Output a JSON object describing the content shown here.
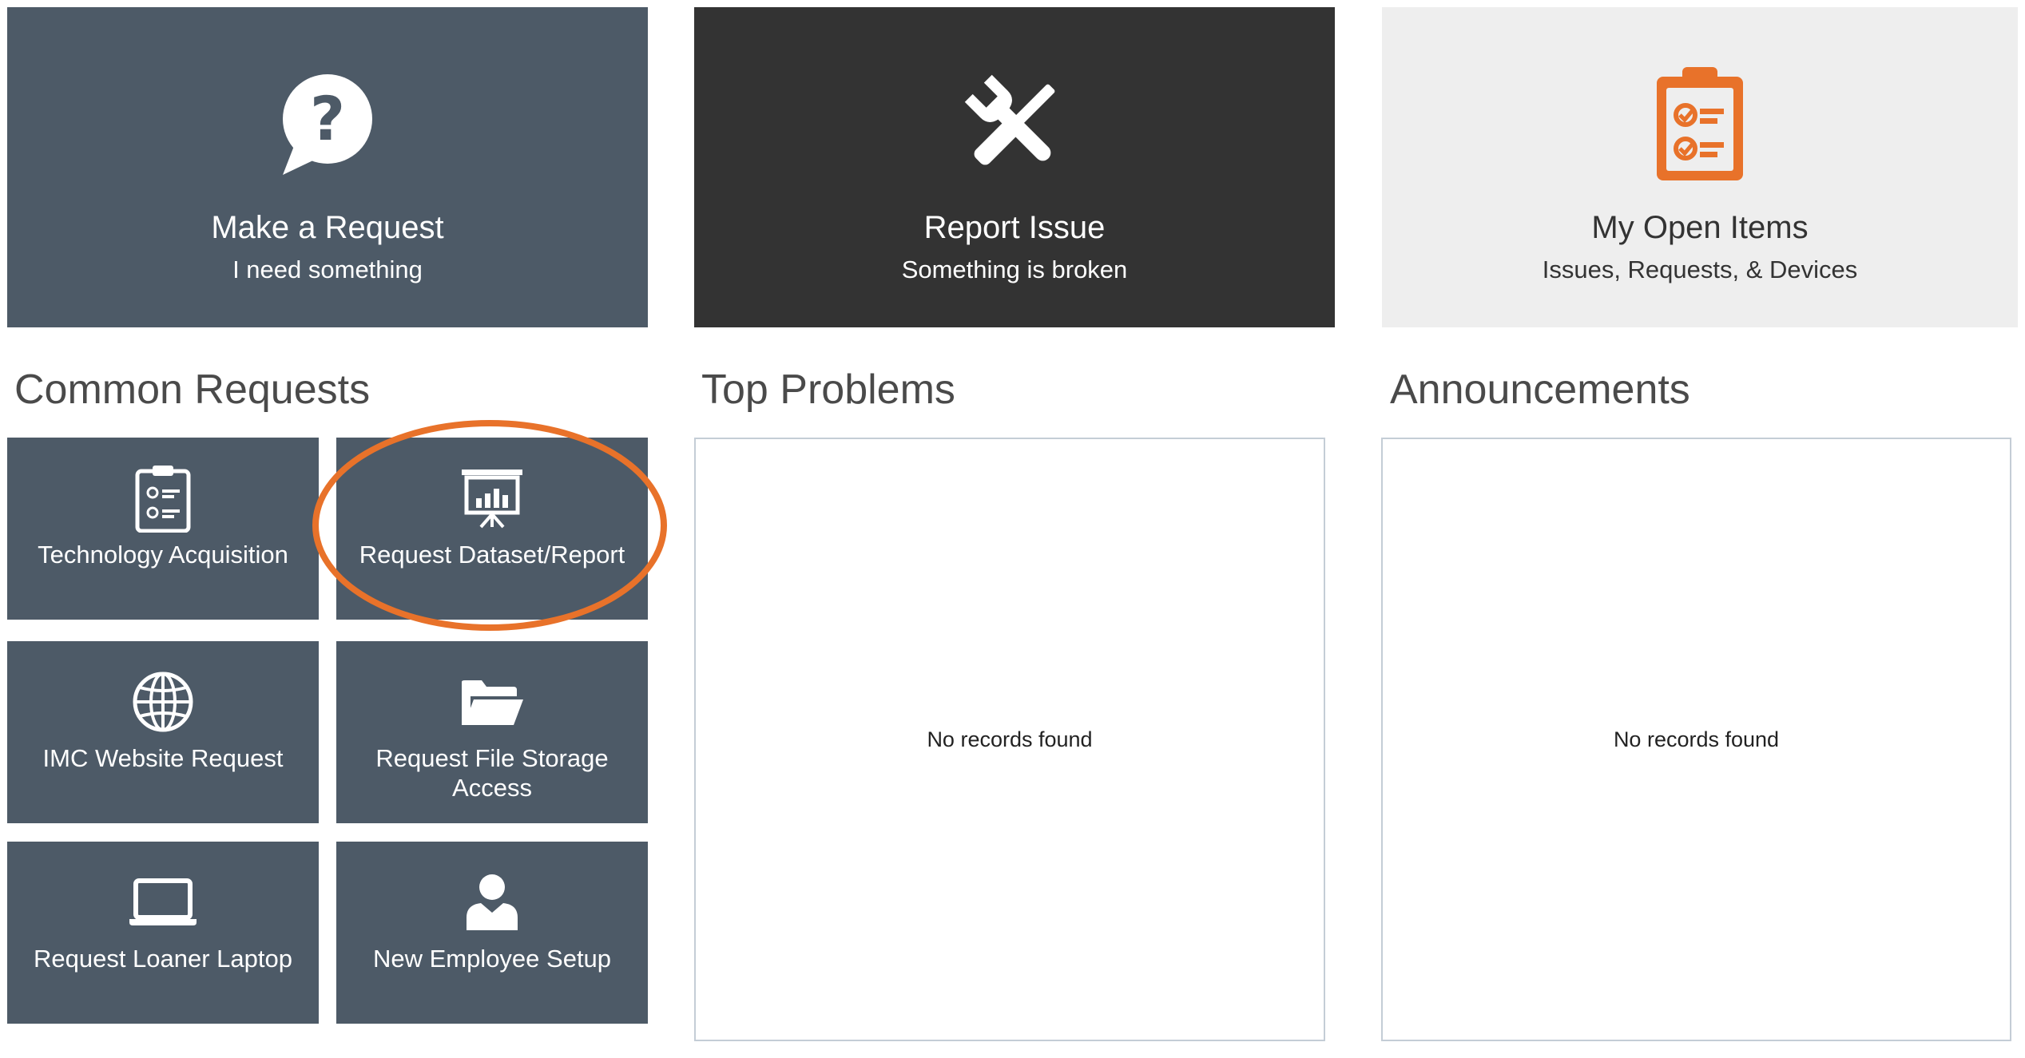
{
  "hero_cards": [
    {
      "title": "Make a Request",
      "subtitle": "I need something",
      "icon": "question-bubble-icon"
    },
    {
      "title": "Report Issue",
      "subtitle": "Something is broken",
      "icon": "tools-icon"
    },
    {
      "title": "My Open Items",
      "subtitle": "Issues, Requests, & Devices",
      "icon": "clipboard-checklist-icon"
    }
  ],
  "sections": {
    "common_requests": "Common Requests",
    "top_problems": "Top Problems",
    "announcements": "Announcements"
  },
  "common_requests": [
    {
      "label": "Technology Acquisition",
      "icon": "clipboard-checklist-icon"
    },
    {
      "label": "Request Dataset/Report",
      "icon": "presentation-chart-icon"
    },
    {
      "label": "IMC Website Request",
      "icon": "globe-icon"
    },
    {
      "label": "Request File Storage Access",
      "icon": "folder-open-icon"
    },
    {
      "label": "Request Loaner Laptop",
      "icon": "laptop-icon"
    },
    {
      "label": "New Employee Setup",
      "icon": "person-icon"
    }
  ],
  "panels": {
    "top_problems_empty": "No records found",
    "announcements_empty": "No records found"
  },
  "colors": {
    "tile_slate": "#4d5a67",
    "tile_dark": "#333333",
    "tile_light": "#eeeeee",
    "accent_orange": "#e8722a"
  }
}
